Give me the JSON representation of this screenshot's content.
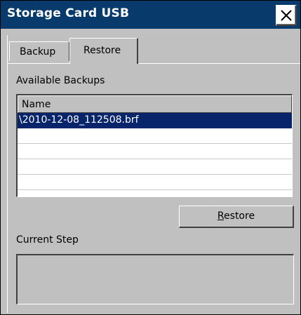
{
  "window": {
    "title": "Storage Card USB",
    "close_icon": "close-x-icon"
  },
  "tabs": [
    {
      "label": "Backup",
      "active": false
    },
    {
      "label": "Restore",
      "active": true
    }
  ],
  "available_backups": {
    "label": "Available Backups",
    "column_header": "Name",
    "rows": [
      {
        "name": "\\2010-12-08_112508.brf",
        "selected": true
      },
      {
        "name": "",
        "selected": false
      },
      {
        "name": "",
        "selected": false
      },
      {
        "name": "",
        "selected": false
      },
      {
        "name": "",
        "selected": false
      }
    ]
  },
  "restore_button": {
    "label": "Restore",
    "mnemonic": "R"
  },
  "current_step": {
    "label": "Current Step",
    "value": ""
  },
  "colors": {
    "titlebar": "#083a6b",
    "selection": "#08246b",
    "face": "#c0c0c0"
  }
}
